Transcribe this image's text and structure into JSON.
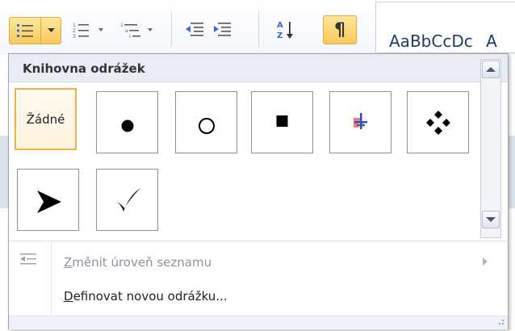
{
  "ribbon": {
    "bullets_button": {
      "icon": "bullet-list-icon",
      "dropdown_icon": "chevron-down-icon"
    },
    "numbering_button": {
      "icon": "numbered-list-icon"
    },
    "multilevel_button": {
      "icon": "multilevel-list-icon"
    },
    "decrease_indent_button": {
      "icon": "decrease-indent-icon"
    },
    "increase_indent_button": {
      "icon": "increase-indent-icon"
    },
    "sort_button": {
      "icon": "sort-az-icon"
    },
    "show_formatting_button": {
      "label": "¶",
      "icon": "pilcrow-icon"
    },
    "styles_gallery": {
      "sample_text": "AaBbCcDc",
      "partial_text": "A"
    }
  },
  "dropdown": {
    "header": "Knihovna odrážek",
    "bullets": [
      {
        "label": "Žádné",
        "icon": "none",
        "selected": true
      },
      {
        "label": "",
        "icon": "filled-circle-bullet-icon",
        "selected": false
      },
      {
        "label": "",
        "icon": "hollow-circle-bullet-icon",
        "selected": false
      },
      {
        "label": "",
        "icon": "filled-square-bullet-icon",
        "selected": false
      },
      {
        "label": "",
        "icon": "colorful-cross-bullet-icon",
        "selected": false
      },
      {
        "label": "",
        "icon": "four-diamond-bullet-icon",
        "selected": false
      },
      {
        "label": "",
        "icon": "arrowhead-bullet-icon",
        "selected": false
      },
      {
        "label": "",
        "icon": "checkmark-bullet-icon",
        "selected": false
      }
    ],
    "menu_items": [
      {
        "label": "Změnit úroveň seznamu",
        "mnemonic": "Z",
        "icon": "change-list-level-icon",
        "enabled": false,
        "has_submenu": true
      },
      {
        "label": "Definovat novou odrážku...",
        "mnemonic": "D",
        "icon": "",
        "enabled": true,
        "has_submenu": false
      }
    ]
  },
  "colors": {
    "highlight_fill": "#f9c85c",
    "highlight_border": "#e3a93c",
    "header_fill": "#e9edf3",
    "disabled_text": "#8d929a"
  }
}
